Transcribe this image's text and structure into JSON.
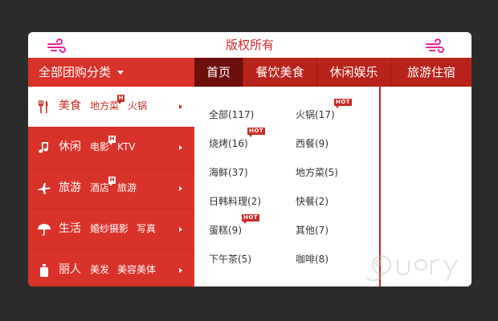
{
  "header": {
    "copyright": "版权所有"
  },
  "nav": {
    "all_categories": "全部团购分类",
    "tabs": [
      {
        "label": "首页"
      },
      {
        "label": "餐饮美食"
      },
      {
        "label": "休闲娱乐"
      },
      {
        "label": "旅游住宿"
      }
    ]
  },
  "sidebar": {
    "items": [
      {
        "icon": "fork-knife-icon",
        "title": "美食",
        "subs": [
          "地方菜",
          "火锅"
        ],
        "badge": "H"
      },
      {
        "icon": "music-note-icon",
        "title": "休闲",
        "subs": [
          "电影",
          "KTV"
        ],
        "badge": "H"
      },
      {
        "icon": "airplane-icon",
        "title": "旅游",
        "subs": [
          "酒店",
          "旅游"
        ],
        "badge": "H"
      },
      {
        "icon": "umbrella-icon",
        "title": "生活",
        "subs": [
          "婚纱摄影",
          "写真"
        ]
      },
      {
        "icon": "person-icon",
        "title": "丽人",
        "subs": [
          "美发",
          "美容美体"
        ]
      }
    ]
  },
  "content": {
    "hot_label": "HOT",
    "categories": [
      {
        "label": "全部(117)"
      },
      {
        "label": "火锅(17)",
        "hot": true
      },
      {
        "label": "烧烤(16)",
        "hot": true
      },
      {
        "label": "西餐(9)"
      },
      {
        "label": "海鲜(37)"
      },
      {
        "label": "地方菜(5)"
      },
      {
        "label": "日韩料理(2)"
      },
      {
        "label": "快餐(2)"
      },
      {
        "label": "蛋糕(9)",
        "hot": true
      },
      {
        "label": "其他(7)"
      },
      {
        "label": "下午茶(5)"
      },
      {
        "label": "咖啡(8)"
      }
    ]
  },
  "colors": {
    "accent": "#d9322a",
    "nav_bg": "#b8231b",
    "nav_active": "#6d0f0a",
    "wind_icon": "#e8249a"
  }
}
